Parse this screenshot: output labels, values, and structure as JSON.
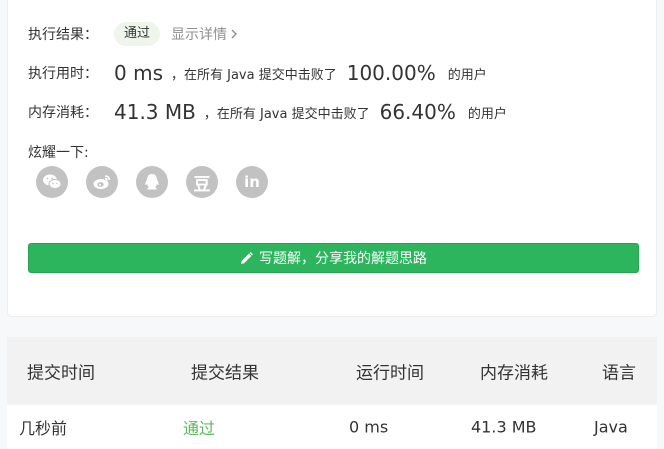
{
  "result": {
    "label": "执行结果：",
    "status": "通过",
    "details_link": "显示详情"
  },
  "runtime": {
    "label": "执行用时：",
    "value": "0 ms",
    "mid_text": "，在所有 Java 提交中击败了",
    "percent": "100.00%",
    "tail_text": "的用户"
  },
  "memory": {
    "label": "内存消耗：",
    "value": "41.3 MB",
    "mid_text": "，在所有 Java 提交中击败了",
    "percent": "66.40%",
    "tail_text": "的用户"
  },
  "share": {
    "label": "炫耀一下:",
    "icons": [
      "wechat-icon",
      "weibo-icon",
      "qq-icon",
      "douban-icon",
      "linkedin-icon"
    ],
    "douban_glyph": "豆",
    "linkedin_glyph": "in"
  },
  "solution_button": {
    "label": "写题解，分享我的解题思路",
    "color": "#2db55d"
  },
  "submissions": {
    "headers": [
      "提交时间",
      "提交结果",
      "运行时间",
      "内存消耗",
      "语言"
    ],
    "rows": [
      {
        "time": "几秒前",
        "result": "通过",
        "runtime": "0 ms",
        "memory": "41.3 MB",
        "language": "Java"
      }
    ]
  },
  "colors": {
    "accent": "#2db55d",
    "pass_text": "#5cb85c",
    "icon_bg": "#c2c2c2"
  }
}
